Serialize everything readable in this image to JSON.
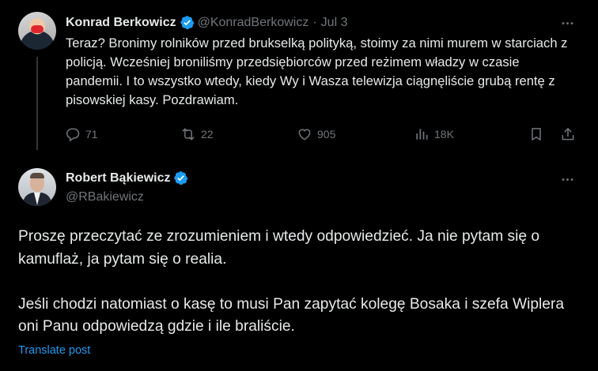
{
  "colors": {
    "background": "#000000",
    "text_primary": "#e7e9ea",
    "text_secondary": "#71767b",
    "accent": "#1d9bf0",
    "thread_line": "#333639"
  },
  "parent_tweet": {
    "author_name": "Konrad Berkowicz",
    "handle": "@KonradBerkowicz",
    "separator": "·",
    "date": "Jul 3",
    "verified_icon": "verified-badge-icon",
    "text": "Teraz? Bronimy rolników przed brukselką polityką, stoimy za nimi murem w starciach z policją. Wcześniej broniliśmy przedsiębiorców przed reżimem władzy w czasie pandemii. I to wszystko wtedy, kiedy Wy i Wasza telewizja ciągnęliście grubą rentę z pisowskiej kasy. Pozdrawiam.",
    "stats": {
      "replies": "71",
      "reposts": "22",
      "likes": "905",
      "views": "18K"
    }
  },
  "main_tweet": {
    "author_name": "Robert Bąkiewicz",
    "handle": "@RBakiewicz",
    "verified_icon": "verified-badge-icon",
    "paragraph_1": "Proszę przeczytać ze zrozumieniem i wtedy odpowiedzieć. Ja nie pytam się o kamuflaż, ja pytam się o realia.",
    "paragraph_2": "Jeśli chodzi natomiast o kasę to musi Pan zapytać kolegę Bosaka i szefa Wiplera oni Panu odpowiedzą gdzie i ile braliście.",
    "translate_label": "Translate post"
  }
}
